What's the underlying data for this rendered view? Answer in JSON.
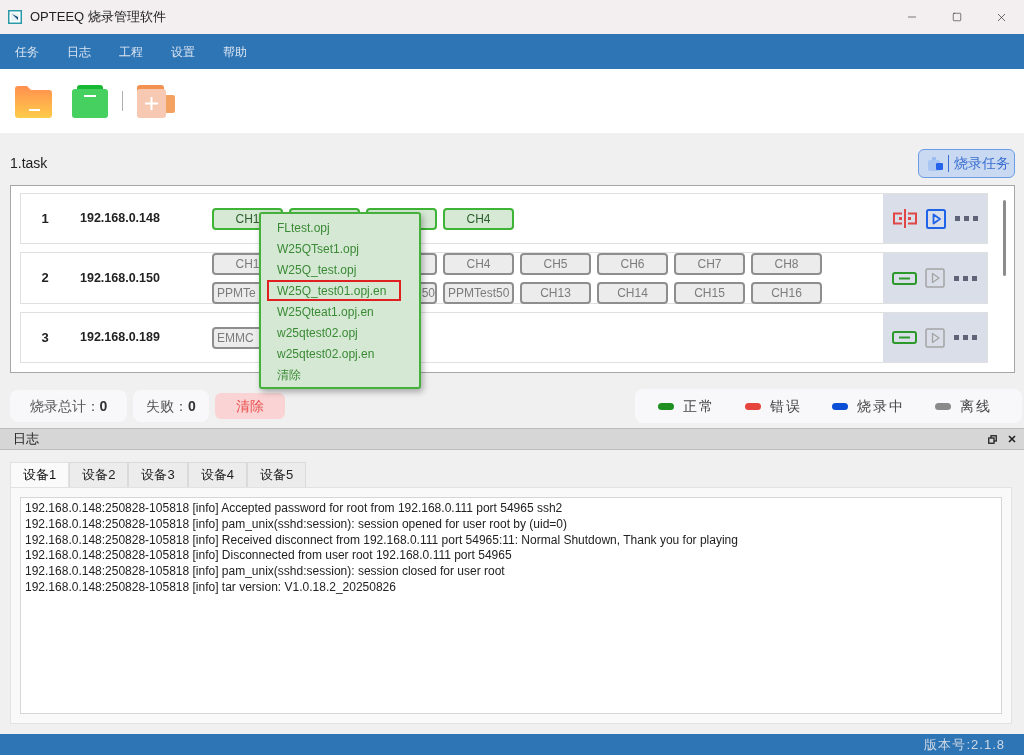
{
  "window": {
    "title": "OPTEEQ 烧录管理软件"
  },
  "menu_bar": [
    {
      "label": "任务"
    },
    {
      "label": "日志"
    },
    {
      "label": "工程"
    },
    {
      "label": "设置"
    },
    {
      "label": "帮助"
    }
  ],
  "task": {
    "name": "1.task",
    "burn_button": "烧录任务"
  },
  "devices": [
    {
      "number": "1",
      "ip": "192.168.0.148",
      "connected": false,
      "play_enabled": true,
      "channel_rows": [
        [
          {
            "kind": "full",
            "label": "CH1",
            "online": true
          },
          {
            "kind": "hidden",
            "online": true
          },
          {
            "kind": "hidden",
            "online": true
          },
          {
            "kind": "full",
            "label": "CH4",
            "online": true
          }
        ]
      ]
    },
    {
      "number": "2",
      "ip": "192.168.0.150",
      "connected": true,
      "play_enabled": false,
      "channel_rows": [
        [
          {
            "kind": "full",
            "label": "CH1",
            "online": false
          },
          {
            "kind": "covered"
          },
          {
            "kind": "hidden",
            "online": false
          },
          {
            "kind": "full",
            "label": "CH4",
            "online": false
          },
          {
            "kind": "full",
            "label": "CH5",
            "online": false
          },
          {
            "kind": "full",
            "label": "CH6",
            "online": false
          },
          {
            "kind": "full",
            "label": "CH7",
            "online": false
          },
          {
            "kind": "full",
            "label": "CH8",
            "online": false
          }
        ],
        [
          {
            "kind": "head",
            "label": "PPMTe",
            "online": false
          },
          {
            "kind": "covered"
          },
          {
            "kind": "tail",
            "label": "50",
            "online": false
          },
          {
            "kind": "head",
            "label": "PPMTest50",
            "online": false
          },
          {
            "kind": "full",
            "label": "CH13",
            "online": false
          },
          {
            "kind": "full",
            "label": "CH14",
            "online": false
          },
          {
            "kind": "full",
            "label": "CH15",
            "online": false
          },
          {
            "kind": "full",
            "label": "CH16",
            "online": false
          }
        ]
      ]
    },
    {
      "number": "3",
      "ip": "192.168.0.189",
      "connected": true,
      "play_enabled": false,
      "channel_rows": [
        [
          {
            "kind": "head",
            "label": "EMMC",
            "online": false
          }
        ]
      ]
    }
  ],
  "file_menu": {
    "items": [
      {
        "label": "FLtest.opj",
        "selected": false
      },
      {
        "label": "W25QTset1.opj",
        "selected": false
      },
      {
        "label": "W25Q_test.opj",
        "selected": false
      },
      {
        "label": "W25Q_test01.opj.en",
        "selected": true
      },
      {
        "label": "W25Qteat1.opj.en",
        "selected": false
      },
      {
        "label": "w25qtest02.opj",
        "selected": false
      },
      {
        "label": "w25qtest02.opj.en",
        "selected": false
      },
      {
        "label": "清除",
        "selected": false
      }
    ]
  },
  "counters": [
    {
      "label": "烧录总计：",
      "value": "0"
    },
    {
      "label": "失败：",
      "value": "0"
    }
  ],
  "clear_button": "清除",
  "legend": [
    {
      "label": "正常",
      "color": "#1f8f1f"
    },
    {
      "label": "错误",
      "color": "#e5453d"
    },
    {
      "label": "烧录中",
      "color": "#0b4fd6"
    },
    {
      "label": "离线",
      "color": "#8a8a8a"
    }
  ],
  "log_panel": {
    "title": "日志",
    "tabs": [
      {
        "label": "设备1",
        "selected": true
      },
      {
        "label": "设备2",
        "selected": false
      },
      {
        "label": "设备3",
        "selected": false
      },
      {
        "label": "设备4",
        "selected": false
      },
      {
        "label": "设备5",
        "selected": false
      }
    ],
    "lines": [
      "192.168.0.148:250828-105818 [info] Accepted password for root from 192.168.0.111 port 54965 ssh2",
      "192.168.0.148:250828-105818 [info] pam_unix(sshd:session): session opened for user root by (uid=0)",
      "192.168.0.148:250828-105818 [info] Received disconnect from 192.168.0.111 port 54965:11: Normal Shutdown, Thank you for playing",
      "192.168.0.148:250828-105818 [info] Disconnected from user root 192.168.0.111 port 54965",
      "192.168.0.148:250828-105818 [info] pam_unix(sshd:session): session closed for user root",
      "192.168.0.148:250828-105818 [info] tar version: V1.0.18.2_20250826"
    ]
  },
  "status_bar": {
    "version": "版本号:2.1.8"
  }
}
